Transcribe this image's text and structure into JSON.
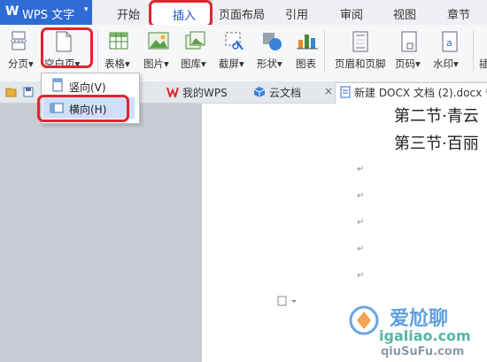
{
  "app": {
    "logo": "W",
    "name": "WPS 文字",
    "caret": "▾"
  },
  "menu_tabs": [
    "开始",
    "插入",
    "页面布局",
    "引用",
    "审阅",
    "视图",
    "章节"
  ],
  "ribbon": {
    "page_break": "分页▾",
    "blank_page": "空白页▾",
    "table": "表格▾",
    "picture": "图片▾",
    "gallery": "图库▾",
    "screenshot": "截屏▾",
    "shapes": "形状▾",
    "chart": "图表",
    "header_footer": "页眉和页脚",
    "page_number": "页码▾",
    "watermark": "水印▾",
    "more": "插"
  },
  "dropdown": {
    "portrait": "竖向(V)",
    "landscape": "横向(H)"
  },
  "doc_tabs": {
    "wps": "我的WPS",
    "cloud": "云文档",
    "active": "新建 DOCX 文档 (2).docx *",
    "close": "×"
  },
  "document": {
    "line1": "第二节·青云",
    "line2": "第三节·百丽",
    "para_mark": "↵"
  },
  "overlay": {
    "site": "igaliao.com",
    "brand": "爱尬聊",
    "bottom": "qiuSuFu.com"
  },
  "colors": {
    "accent": "#2f6bd5",
    "highlight_ring": "#e0252d",
    "selected_item": "#cde0f7"
  }
}
